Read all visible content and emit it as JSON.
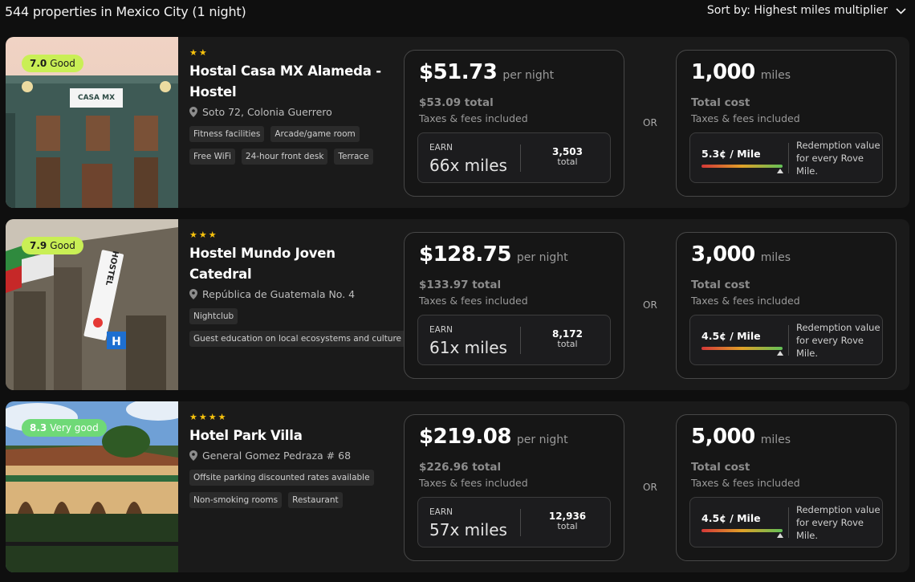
{
  "header": {
    "results_text": "544 properties in Mexico City (1 night)",
    "sort_label": "Sort by: Highest miles multiplier"
  },
  "or_label": "OR",
  "hotels": [
    {
      "rating_score": "7.0",
      "rating_label": "Good",
      "stars": 2,
      "name": "Hostal Casa MX Alameda - Hostel",
      "address": "Soto 72, Colonia Guerrero",
      "amenities": [
        "Fitness facilities",
        "Arcade/game room",
        "Free WiFi",
        "24-hour front desk",
        "Terrace"
      ],
      "price": "$51.73",
      "per_night": "per night",
      "total": "$53.09 total",
      "taxes": "Taxes & fees included",
      "earn_label": "EARN",
      "earn_multiplier": "66x miles",
      "earn_total_num": "3,503",
      "earn_total_label": "total",
      "miles_cost": "1,000",
      "miles_unit": "miles",
      "miles_total_label": "Total cost",
      "miles_taxes": "Taxes & fees included",
      "redemption_rate": "5.3¢ / Mile",
      "redemption_note": "Redemption value for every Rove Mile.",
      "redemption_level": 0.97
    },
    {
      "rating_score": "7.9",
      "rating_label": "Good",
      "stars": 3,
      "name": "Hostel Mundo Joven Catedral",
      "address": "República de Guatemala No. 4",
      "amenities": [
        "Nightclub",
        "Guest education on local ecosystems and culture"
      ],
      "price": "$128.75",
      "per_night": "per night",
      "total": "$133.97 total",
      "taxes": "Taxes & fees included",
      "earn_label": "EARN",
      "earn_multiplier": "61x miles",
      "earn_total_num": "8,172",
      "earn_total_label": "total",
      "miles_cost": "3,000",
      "miles_unit": "miles",
      "miles_total_label": "Total cost",
      "miles_taxes": "Taxes & fees included",
      "redemption_rate": "4.5¢ / Mile",
      "redemption_note": "Redemption value for every Rove Mile.",
      "redemption_level": 0.97
    },
    {
      "rating_score": "8.3",
      "rating_label": "Very good",
      "stars": 4,
      "name": "Hotel Park Villa",
      "address": "General Gomez Pedraza # 68",
      "amenities": [
        "Offsite parking discounted rates available",
        "Non-smoking rooms",
        "Restaurant"
      ],
      "price": "$219.08",
      "per_night": "per night",
      "total": "$226.96 total",
      "taxes": "Taxes & fees included",
      "earn_label": "EARN",
      "earn_multiplier": "57x miles",
      "earn_total_num": "12,936",
      "earn_total_label": "total",
      "miles_cost": "5,000",
      "miles_unit": "miles",
      "miles_total_label": "Total cost",
      "miles_taxes": "Taxes & fees included",
      "redemption_rate": "4.5¢ / Mile",
      "redemption_note": "Redemption value for every Rove Mile.",
      "redemption_level": 0.97
    }
  ]
}
